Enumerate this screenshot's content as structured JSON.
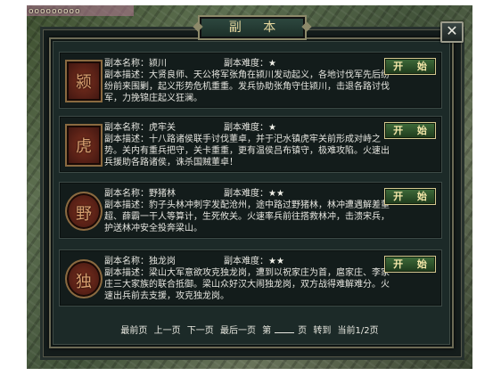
{
  "title": "副  本",
  "close_label": "✕",
  "scene_text": "ooooooooo",
  "labels": {
    "name": "副本名称：",
    "difficulty": "副本难度：",
    "desc": "副本描述：",
    "start": "开 始"
  },
  "dungeons": [
    {
      "emblem": "颍",
      "name": "颍川",
      "difficulty": "★",
      "desc": "大贤良师、天公将军张角在颍川发动起义，各地讨伐军先后纷纷前来围剿，起义形势危机重重。发兵协助张角守住颍川，击退各路讨伐军，力挽锦庄起义狂澜。"
    },
    {
      "emblem": "虎",
      "name": "虎牢关",
      "difficulty": "★",
      "desc": "十八路诸侯联手讨伐董卓，并于汜水镇虎牢关前形成对峙之势。关内有重兵把守，关卡重重，更有温侯吕布镇守，极难攻陷。火速出兵援助各路诸侯，诛杀国贼董卓！"
    },
    {
      "emblem": "野",
      "name": "野猪林",
      "difficulty": "★★",
      "desc": "豹子头林冲刺字发配沧州，途中路过野猪林，林冲遭遇解差董超、薛霸一干人等算计，生死攸关。火速率兵前往搭救林冲，击溃宋兵，护送林冲安全投奔梁山。"
    },
    {
      "emblem": "独",
      "name": "独龙岗",
      "difficulty": "★★",
      "desc": "梁山大军意欲攻克独龙岗，遭到以祝家庄为首，扈家庄、李家庄三大家族的联合抵御。梁山众好汉大闹独龙岗，双方战得难解难分。火速出兵前去支援，攻克独龙岗。"
    }
  ],
  "pager": {
    "first": "最前页",
    "prev": "上一页",
    "next": "下一页",
    "last": "最后一页",
    "page_prefix": "第",
    "page_suffix": "页",
    "goto": "转到",
    "current": "当前1/2页"
  }
}
